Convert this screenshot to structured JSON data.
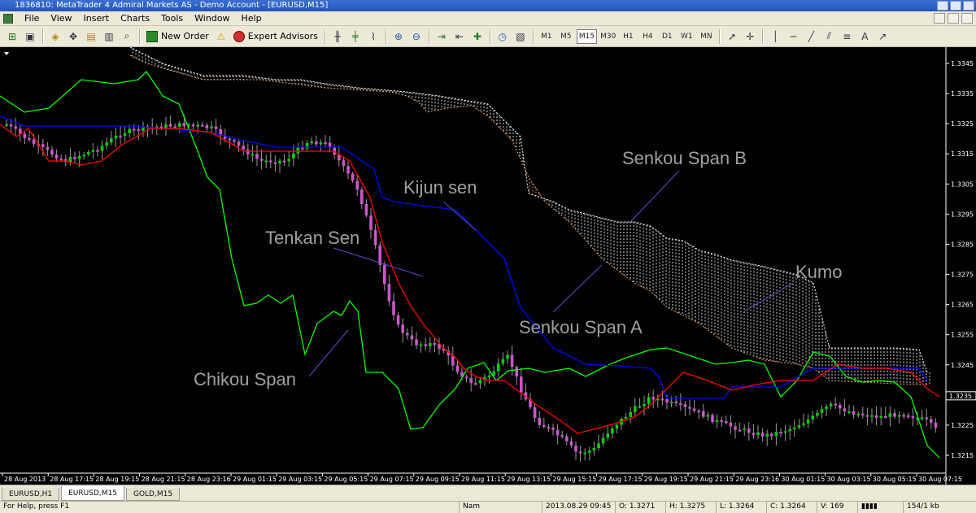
{
  "window": {
    "title": "1836810: MetaTrader 4 Admiral Markets AS - Demo Account - [EURUSD,M15]"
  },
  "menu": {
    "items": [
      "File",
      "View",
      "Insert",
      "Charts",
      "Tools",
      "Window",
      "Help"
    ]
  },
  "toolbar": {
    "new_order_label": "New Order",
    "expert_advisors_label": "Expert Advisors",
    "timeframes": [
      "M1",
      "M5",
      "M15",
      "M30",
      "H1",
      "H4",
      "D1",
      "W1",
      "MN"
    ],
    "active_timeframe": "M15",
    "icons": [
      "new-chart-icon",
      "profiles-icon",
      "market-watch-icon",
      "navigator-icon",
      "data-window-icon",
      "terminal-icon",
      "new-order-icon",
      "alert-icon",
      "expert-advisors-icon",
      "bar-chart-icon",
      "candlestick-icon",
      "line-chart-icon",
      "zoom-in-icon",
      "zoom-out-icon",
      "tile-icon",
      "autoscroll-icon",
      "chart-shift-icon",
      "indicators-icon",
      "periods-icon",
      "templates-icon",
      "cursor-icon",
      "crosshair-icon",
      "vertical-line-icon",
      "horizontal-line-icon",
      "trendline-icon",
      "channel-icon",
      "fibonacci-icon",
      "text-icon",
      "arrow-icon"
    ]
  },
  "chart_data": {
    "type": "candlestick",
    "symbol": "EURUSD",
    "timeframe": "M15",
    "y_ticks": [
      "1.3345",
      "1.3335",
      "1.3325",
      "1.3315",
      "1.3305",
      "1.3295",
      "1.3285",
      "1.3275",
      "1.3265",
      "1.3255",
      "1.3245",
      "1.3235",
      "1.3225",
      "1.3215"
    ],
    "x_ticks": [
      "28 Aug 2013",
      "28 Aug 17:15",
      "28 Aug 19:15",
      "28 Aug 21:15",
      "28 Aug 23:16",
      "29 Aug 01:15",
      "29 Aug 03:15",
      "29 Aug 05:15",
      "29 Aug 07:15",
      "29 Aug 09:15",
      "29 Aug 11:15",
      "29 Aug 13:15",
      "29 Aug 15:15",
      "29 Aug 17:15",
      "29 Aug 19:15",
      "29 Aug 21:15",
      "29 Aug 23:16",
      "30 Aug 01:15",
      "30 Aug 03:15",
      "30 Aug 05:15",
      "30 Aug 07:15"
    ],
    "current_price": "1.3235",
    "annotations": [
      "Kijun sen",
      "Tenkan Sen",
      "Senkou Span B",
      "Senkou Span A",
      "Kumo",
      "Chikou Span"
    ],
    "colors": {
      "background": "#000000",
      "bull_candle": "#00cc00",
      "bear_candle": "#cc55cc",
      "tenkan": "#ff0000",
      "kijun": "#0000ff",
      "chikou": "#00ff00",
      "span_a": "#f4a460",
      "span_b": "#ffffff",
      "labels": "#a0a0a0"
    }
  },
  "chart_tabs": [
    "EURUSD,H1",
    "EURUSD,M15",
    "GOLD,M15"
  ],
  "active_tab": "EURUSD,M15",
  "status": {
    "help": "For Help, press F1",
    "profile": "Nam",
    "datetime": "2013.08.29 09:45",
    "open": "O: 1.3271",
    "high": "H: 1.3275",
    "low": "L: 1.3264",
    "close": "C: 1.3264",
    "volume": "V: 169",
    "traffic": "154/1 kb"
  }
}
